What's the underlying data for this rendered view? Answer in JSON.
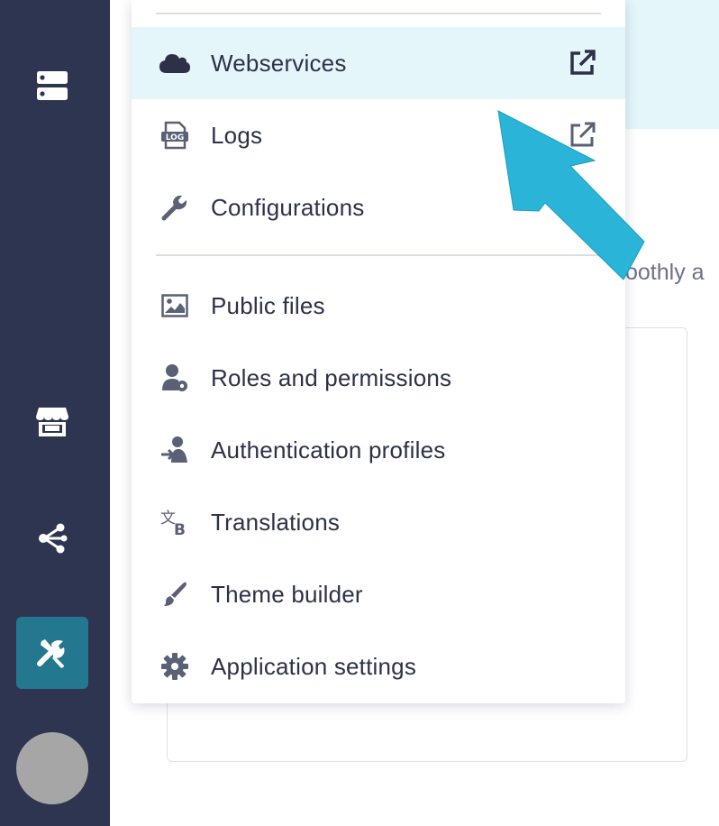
{
  "background": {
    "partial_text": "oothly a"
  },
  "menu": {
    "items": [
      {
        "label": "Webservices",
        "icon": "cloud-icon",
        "external": true,
        "highlighted": true
      },
      {
        "label": "Logs",
        "icon": "log-icon",
        "external": true
      },
      {
        "label": "Configurations",
        "icon": "wrench-icon",
        "external": true
      },
      {
        "label": "Public files",
        "icon": "image-icon"
      },
      {
        "label": "Roles and permissions",
        "icon": "user-lock-icon"
      },
      {
        "label": "Authentication profiles",
        "icon": "user-login-icon"
      },
      {
        "label": "Translations",
        "icon": "translate-icon"
      },
      {
        "label": "Theme builder",
        "icon": "paintbrush-icon"
      },
      {
        "label": "Application settings",
        "icon": "gear-icon"
      }
    ]
  },
  "sidebar": {
    "items": [
      {
        "icon": "server-icon"
      },
      {
        "icon": "store-icon"
      },
      {
        "icon": "share-icon"
      },
      {
        "icon": "tools-icon",
        "active": true
      }
    ]
  },
  "colors": {
    "sidebar_bg": "#2e3550",
    "active_bg": "#23778e",
    "highlight_bg": "#e4f6fa",
    "arrow": "#2ab4d8",
    "text": "#2c3148"
  }
}
